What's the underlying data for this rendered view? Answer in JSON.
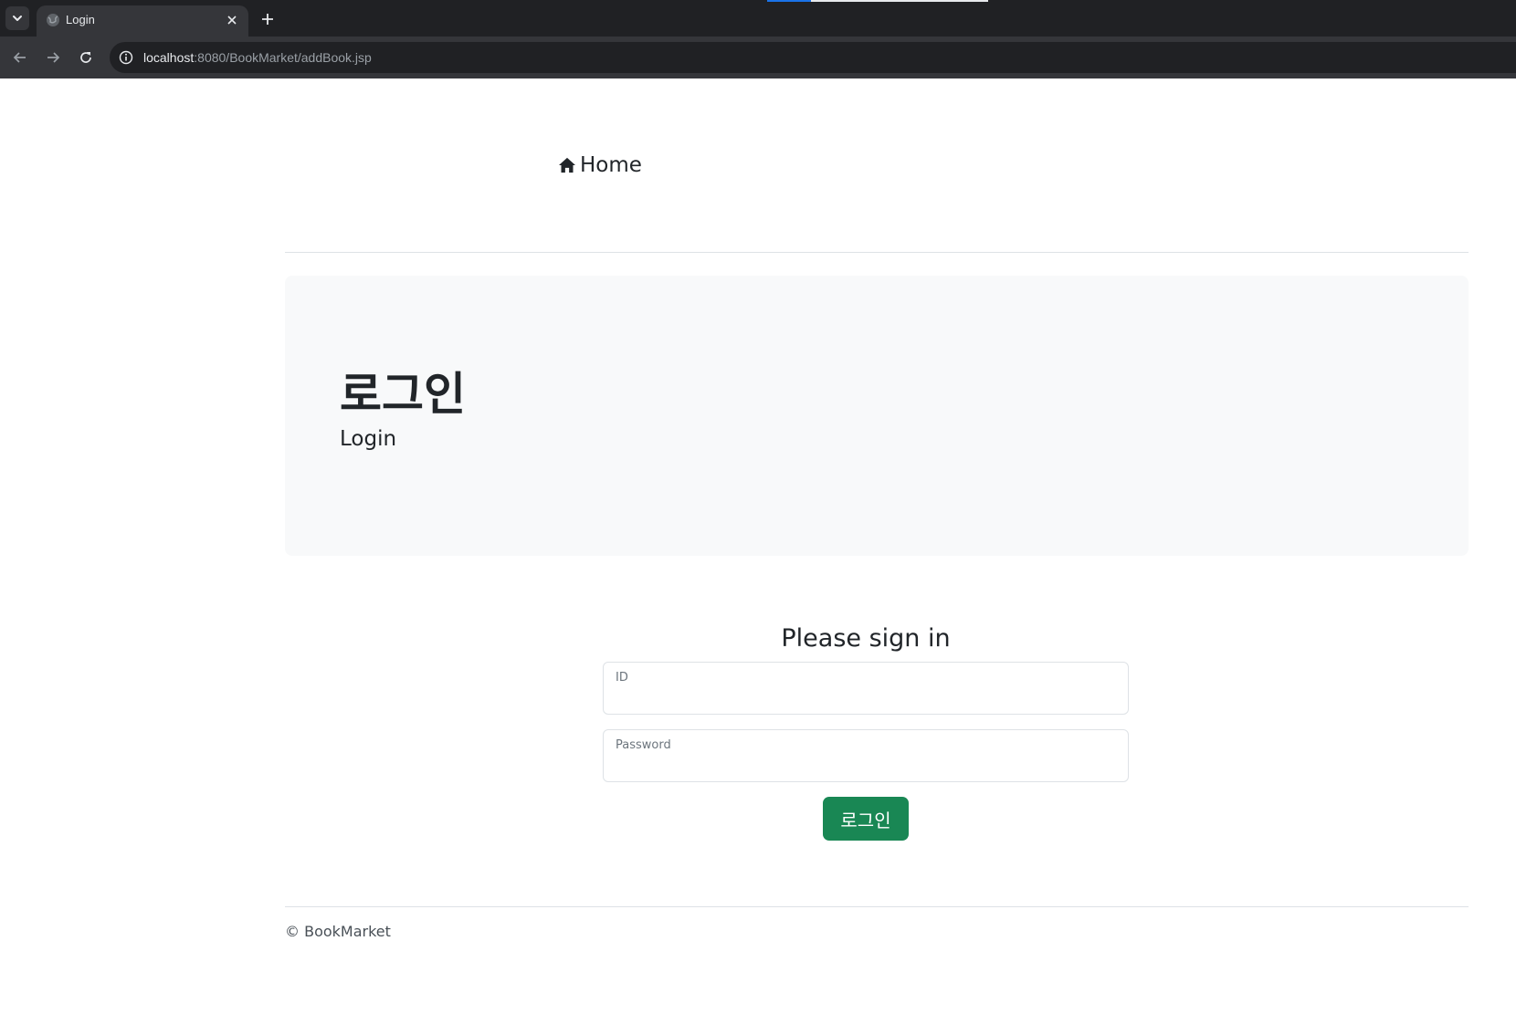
{
  "browser": {
    "tab_title": "Login",
    "url_host": "localhost",
    "url_rest": ":8080/BookMarket/addBook.jsp",
    "icons": {
      "tab_dropdown": "chevron-down-icon",
      "favicon": "globe-icon",
      "tab_close": "close-icon",
      "new_tab": "plus-icon",
      "back": "arrow-left-icon",
      "forward": "arrow-right-icon",
      "reload": "reload-icon",
      "site_info": "info-icon"
    }
  },
  "nav": {
    "home_label": "Home",
    "home_icon": "home-icon"
  },
  "jumbotron": {
    "title": "로그인",
    "subtitle": "Login"
  },
  "form": {
    "heading": "Please sign in",
    "id_label": "ID",
    "password_label": "Password",
    "id_value": "",
    "password_value": "",
    "submit_label": "로그인"
  },
  "footer": {
    "text": "© BookMarket"
  },
  "colors": {
    "primary_button": "#198754",
    "jumbotron_bg": "#f8f9fa",
    "chrome_dark": "#202124",
    "chrome_toolbar": "#35363a"
  }
}
